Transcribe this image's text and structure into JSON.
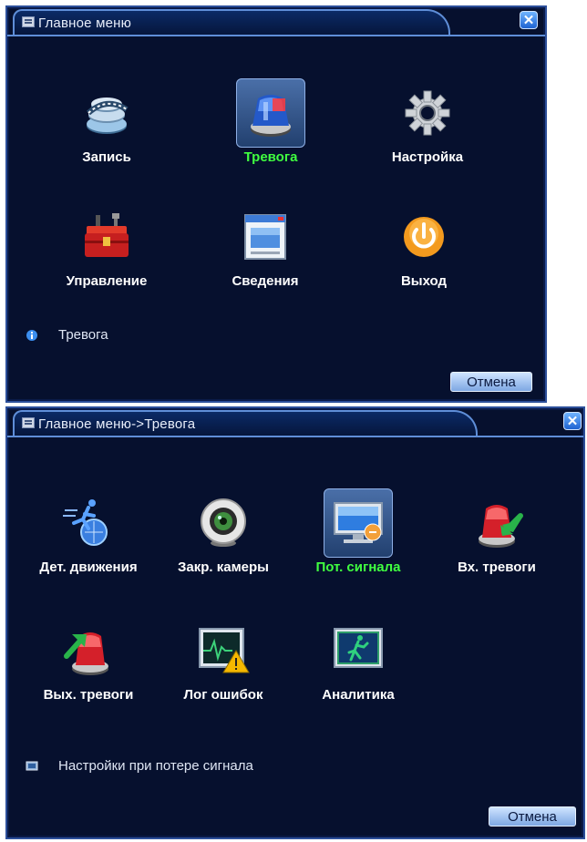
{
  "window1": {
    "title": "Главное меню",
    "items": [
      {
        "label": "Запись",
        "icon": "record-film-icon"
      },
      {
        "label": "Тревога",
        "icon": "alarm-siren-icon",
        "selected": true
      },
      {
        "label": "Настройка",
        "icon": "gear-icon"
      },
      {
        "label": "Управление",
        "icon": "toolbox-icon"
      },
      {
        "label": "Сведения",
        "icon": "info-window-icon"
      },
      {
        "label": "Выход",
        "icon": "power-icon"
      }
    ],
    "hint": "Тревога",
    "cancel": "Отмена"
  },
  "window2": {
    "title": "Главное меню->Тревога",
    "items": [
      {
        "label": "Дет. движения",
        "icon": "motion-detect-icon"
      },
      {
        "label": "Закр. камеры",
        "icon": "camera-lens-icon"
      },
      {
        "label": "Пот. сигнала",
        "icon": "video-loss-monitor-icon",
        "selected": true
      },
      {
        "label": "Вх. тревоги",
        "icon": "alarm-input-icon"
      },
      {
        "label": "Вых. тревоги",
        "icon": "alarm-output-icon"
      },
      {
        "label": "Лог ошибок",
        "icon": "error-log-icon"
      },
      {
        "label": "Аналитика",
        "icon": "analytics-icon"
      }
    ],
    "hint": "Настройки при потере сигнала",
    "cancel": "Отмена"
  },
  "colors": {
    "background": "#06102e",
    "border": "#5f8ed8",
    "selected_label": "#40ff40"
  }
}
